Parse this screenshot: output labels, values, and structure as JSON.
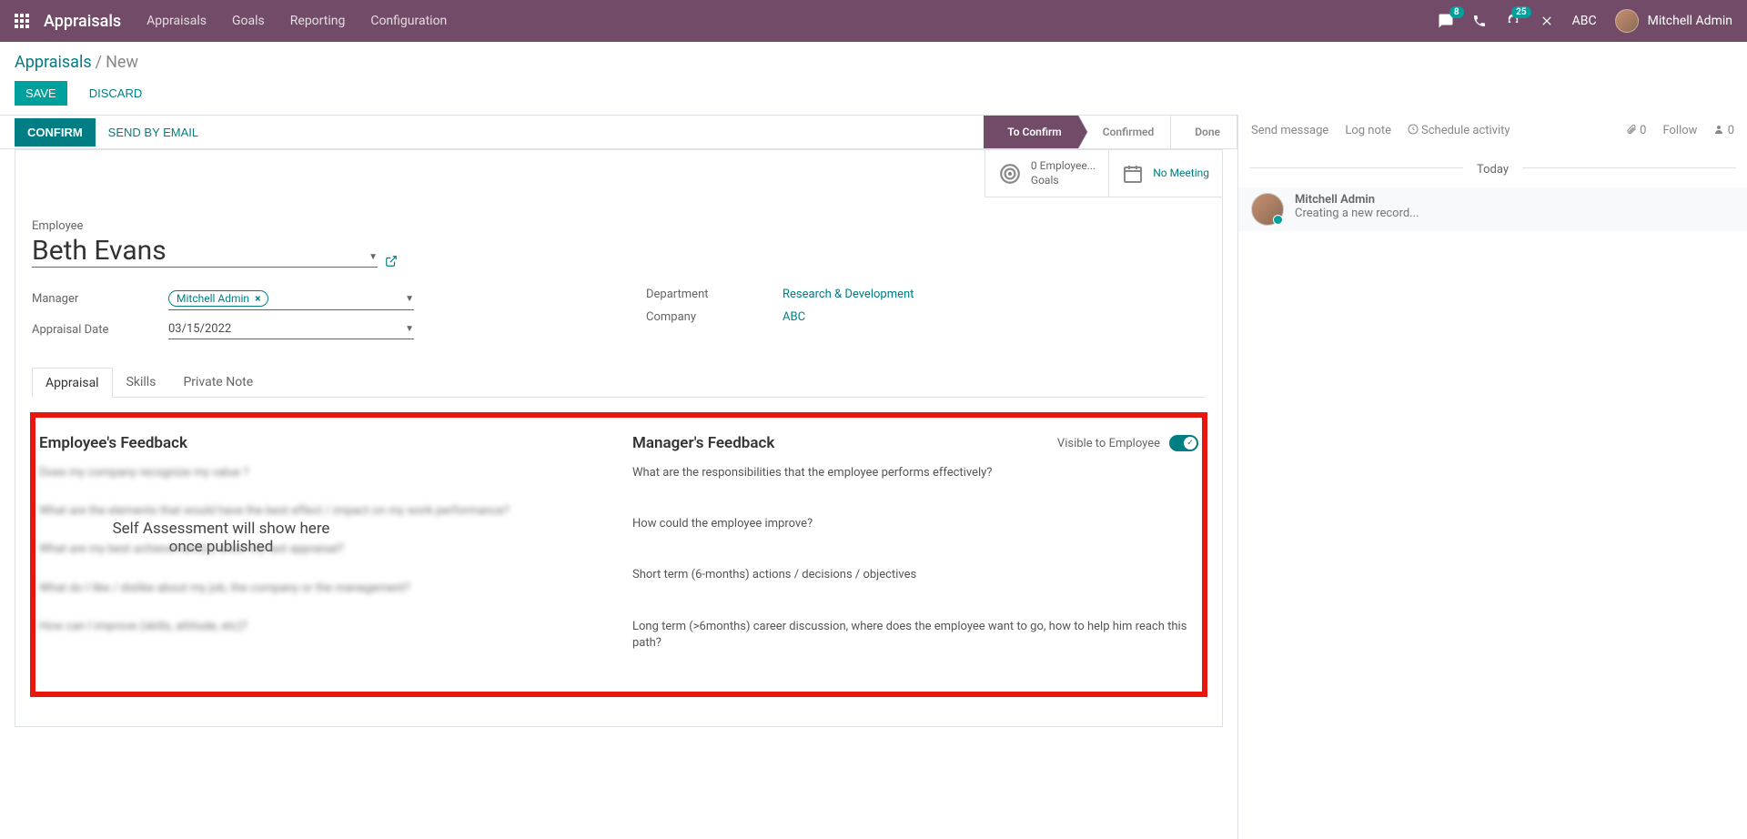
{
  "topnav": {
    "brand": "Appraisals",
    "menu": [
      "Appraisals",
      "Goals",
      "Reporting",
      "Configuration"
    ],
    "chat_badge": "8",
    "activities_badge": "25",
    "company": "ABC",
    "user": "Mitchell Admin"
  },
  "breadcrumb": {
    "root": "Appraisals",
    "current": "New"
  },
  "cp_buttons": {
    "save": "Save",
    "discard": "Discard"
  },
  "statusbar": {
    "confirm": "Confirm",
    "send_email": "Send By Email",
    "steps": [
      "To Confirm",
      "Confirmed",
      "Done"
    ]
  },
  "stat_buttons": {
    "goals_l1": "0 Employee...",
    "goals_l2": "Goals",
    "meeting": "No Meeting"
  },
  "form": {
    "employee_label": "Employee",
    "employee_value": "Beth Evans",
    "manager_label": "Manager",
    "manager_tag": "Mitchell Admin",
    "appraisal_date_label": "Appraisal Date",
    "appraisal_date_value": "03/15/2022",
    "department_label": "Department",
    "department_value": "Research & Development",
    "company_label": "Company",
    "company_value": "ABC"
  },
  "tabs": [
    "Appraisal",
    "Skills",
    "Private Note"
  ],
  "feedback": {
    "emp_title": "Employee's Feedback",
    "mgr_title": "Manager's Feedback",
    "visible_label": "Visible to Employee",
    "overlay_l1": "Self Assessment will show here",
    "overlay_l2": "once published",
    "emp_q1": "Does my company recognize my value ?",
    "emp_q2": "What are the elements that would have the best effect / impact on my work performance?",
    "emp_q3": "What are my best achievement(s) since my last appraisal?",
    "emp_q4": "What do I like / dislike about my job, the company or the management?",
    "emp_q5": "How can I improve (skills, attitude, etc)?",
    "mgr_q1": "What are the responsibilities that the employee performs effectively?",
    "mgr_q2": "How could the employee improve?",
    "mgr_q3": "Short term (6-months) actions / decisions / objectives",
    "mgr_q4": "Long term (>6months) career discussion, where does the employee want to go, how to help him reach this path?"
  },
  "chatter": {
    "send": "Send message",
    "log": "Log note",
    "schedule": "Schedule activity",
    "attach_count": "0",
    "follow": "Follow",
    "follower_count": "0",
    "today": "Today",
    "msg_author": "Mitchell Admin",
    "msg_text": "Creating a new record..."
  }
}
